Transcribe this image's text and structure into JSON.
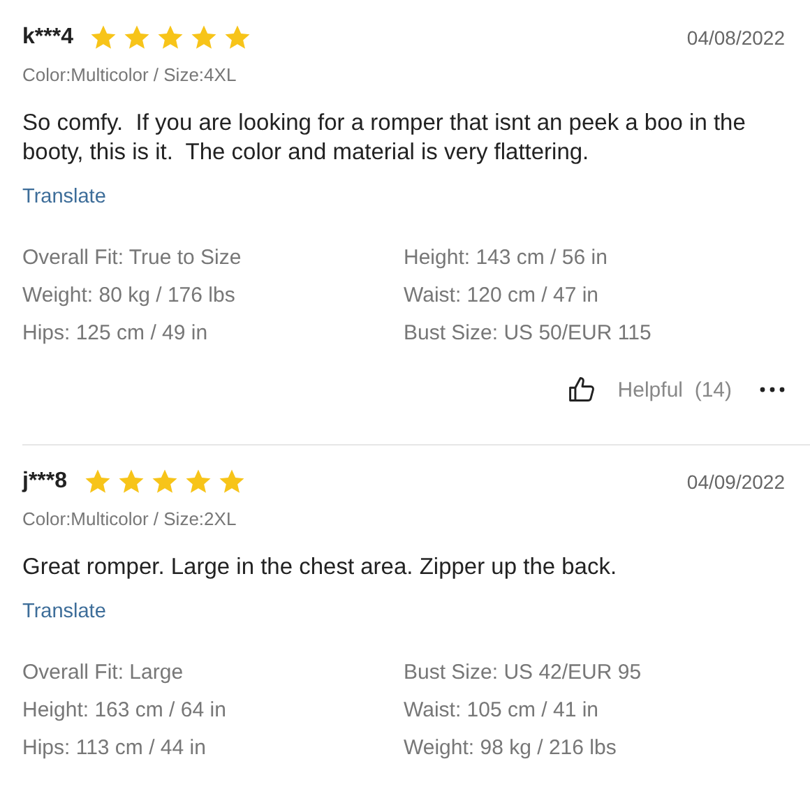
{
  "reviews": [
    {
      "user": "k***4",
      "stars": 5,
      "date": "04/08/2022",
      "variant": "Color:Multicolor / Size:4XL",
      "text": "So comfy.  If you are looking for a romper that isnt an peek a boo in the booty, this is it.  The color and material is very flattering.",
      "translate": "Translate",
      "measurements": [
        "Overall Fit: True to Size",
        "Height: 143 cm / 56 in",
        "Weight: 80 kg / 176 lbs",
        "Waist: 120 cm / 47 in",
        "Hips: 125 cm / 49 in",
        "Bust Size: US 50/EUR 115"
      ],
      "helpful": {
        "label": "Helpful",
        "count": "(14)"
      }
    },
    {
      "user": "j***8",
      "stars": 5,
      "date": "04/09/2022",
      "variant": "Color:Multicolor / Size:2XL",
      "text": "Great romper. Large in the chest area. Zipper up the back.",
      "translate": "Translate",
      "measurements": [
        "Overall Fit: Large",
        "Bust Size: US 42/EUR 95",
        "Height: 163 cm / 64 in",
        "Waist: 105 cm / 41 in",
        "Hips: 113 cm / 44 in",
        "Weight: 98 kg / 216 lbs"
      ]
    }
  ]
}
